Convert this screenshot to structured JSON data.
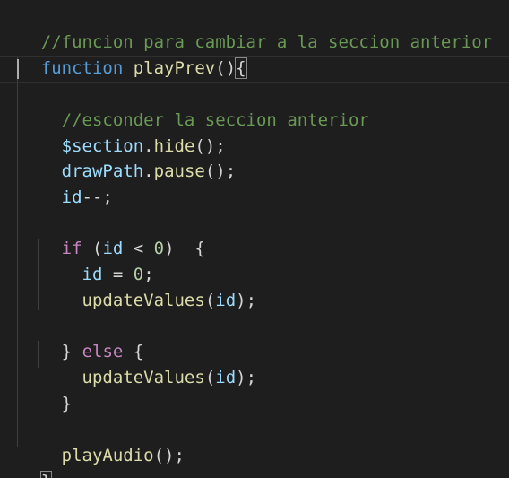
{
  "code": {
    "comment_top": "//funcion para cambiar a la seccion anterior",
    "keyword_function": "function",
    "fn_name": "playPrev",
    "paren_open_close": "()",
    "brace_open": "{",
    "comment_inner": "//esconder la seccion anterior",
    "section_var": "$section",
    "dot": ".",
    "hide_fn": "hide",
    "call_end": "();",
    "drawpath_var": "drawPath",
    "pause_fn": "pause",
    "id_var": "id",
    "decrement": "--;",
    "kw_if": "if",
    "paren_open": "(",
    "lt_op": " < ",
    "zero": "0",
    "paren_close_brace": ")  {",
    "assign": " = ",
    "semicolon": ";",
    "update_fn": "updateValues",
    "paren_close_semi": ");",
    "brace_close": "}",
    "kw_else": "else",
    "space_brace_open": " {",
    "play_audio_fn": "playAudio",
    "closing": "};"
  },
  "colors": {
    "background": "#1e1e1e",
    "comment": "#6a9955",
    "keyword": "#569cd6",
    "control_keyword": "#c586c0",
    "function": "#dcdcaa",
    "variable": "#9cdcfe",
    "number": "#b5cea8",
    "punctuation": "#d4d4d4"
  }
}
